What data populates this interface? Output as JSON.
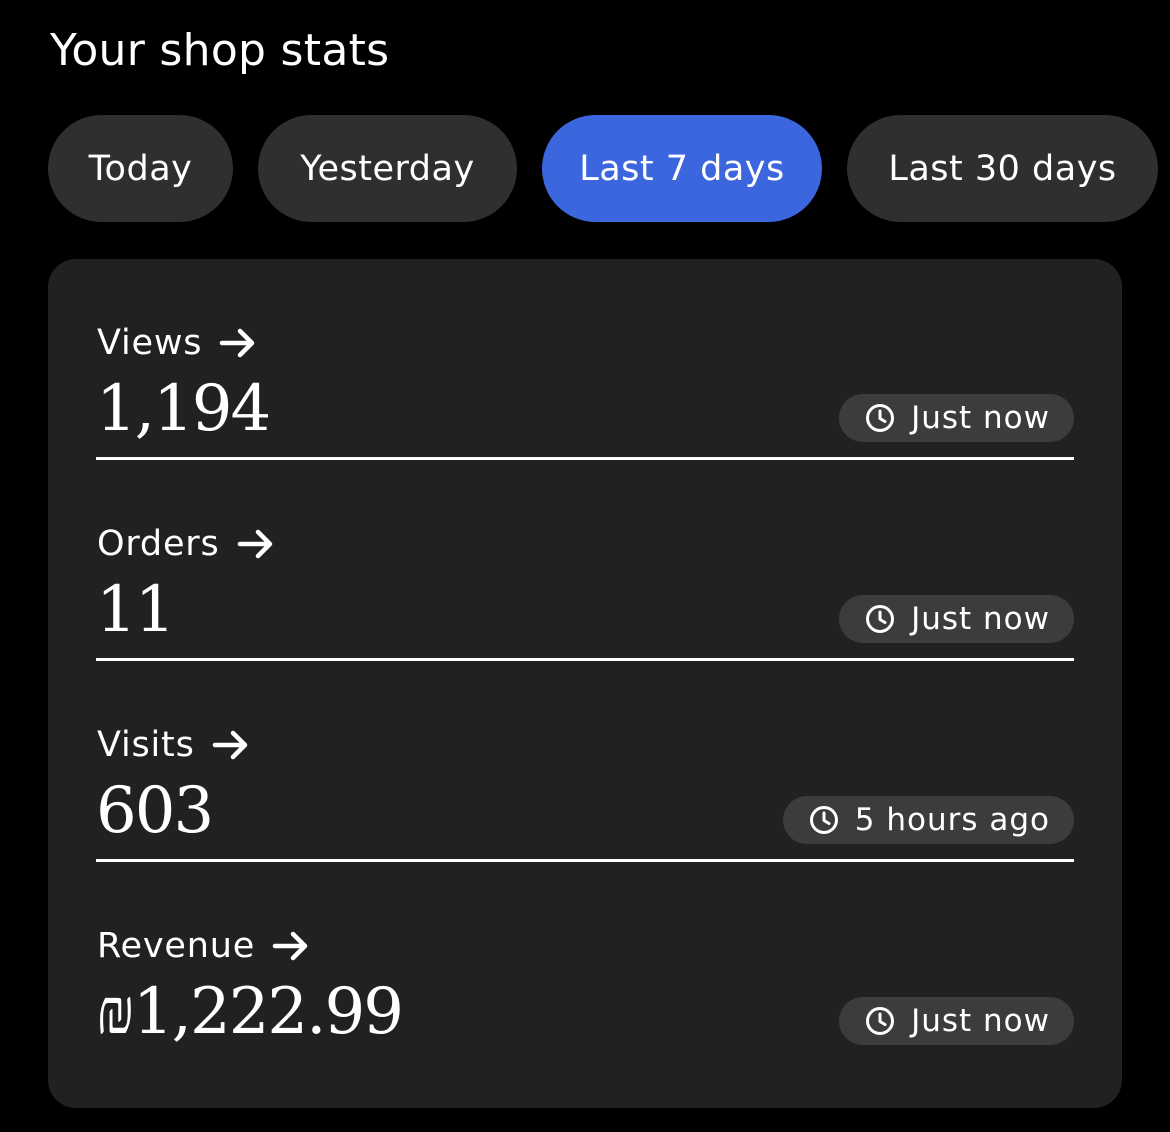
{
  "header": {
    "title": "Your shop stats"
  },
  "tabs": [
    {
      "label": "Today",
      "active": false
    },
    {
      "label": "Yesterday",
      "active": false
    },
    {
      "label": "Last 7 days",
      "active": true
    },
    {
      "label": "Last 30 days",
      "active": false
    }
  ],
  "colors": {
    "active_tab": "#3b66dd",
    "tab_bg": "#2f2f2f",
    "card_bg": "#212121",
    "badge_bg": "#3c3c3c"
  },
  "stats": [
    {
      "label": "Views",
      "value": "1,194",
      "updated": "Just now",
      "icon": "arrow-right-icon"
    },
    {
      "label": "Orders",
      "value": "11",
      "updated": "Just now",
      "icon": "arrow-right-icon"
    },
    {
      "label": "Visits",
      "value": "603",
      "updated": "5 hours ago",
      "icon": "arrow-right-icon"
    },
    {
      "label": "Revenue",
      "value": "₪1,222.99",
      "updated": "Just now",
      "icon": "arrow-right-icon"
    }
  ]
}
